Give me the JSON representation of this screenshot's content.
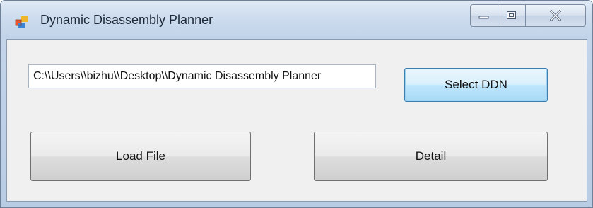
{
  "window": {
    "title": "Dynamic Disassembly Planner",
    "icon": "app-window-icon",
    "controls": {
      "minimize_icon": "minimize-icon",
      "maximize_icon": "maximize-icon",
      "close_icon": "close-icon"
    }
  },
  "form": {
    "path_value": "C:\\\\Users\\\\bizhu\\\\Desktop\\\\Dynamic Disassembly Planner",
    "select_button_label": "Select DDN",
    "load_button_label": "Load File",
    "detail_button_label": "Detail"
  },
  "colors": {
    "title_bar": "#cddcee",
    "client_background": "#f0f0f0",
    "focused_button_border": "#3c7fb1"
  }
}
